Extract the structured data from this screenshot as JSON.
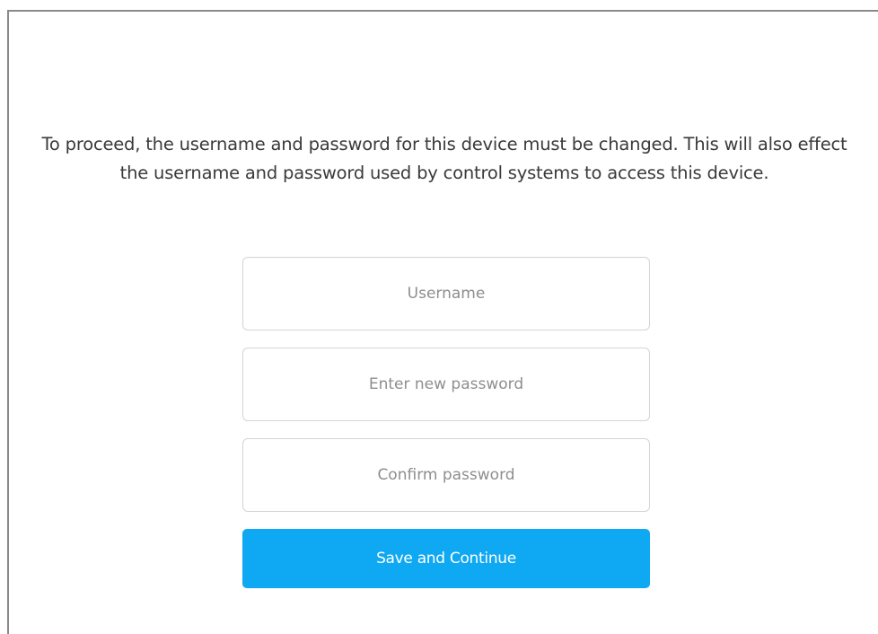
{
  "form": {
    "message": "To proceed, the username and password for this device must be changed. This will also effect the username and password used by control systems to access this device.",
    "username_placeholder": "Username",
    "username_value": "",
    "new_password_placeholder": "Enter new password",
    "new_password_value": "",
    "confirm_password_placeholder": "Confirm password",
    "confirm_password_value": "",
    "submit_label": "Save and Continue"
  },
  "colors": {
    "accent": "#0fa8f2",
    "text": "#3a3a3a",
    "placeholder": "#8e8e8e",
    "field_border": "#d4d4d4",
    "frame_border": "#8a8a8a"
  }
}
